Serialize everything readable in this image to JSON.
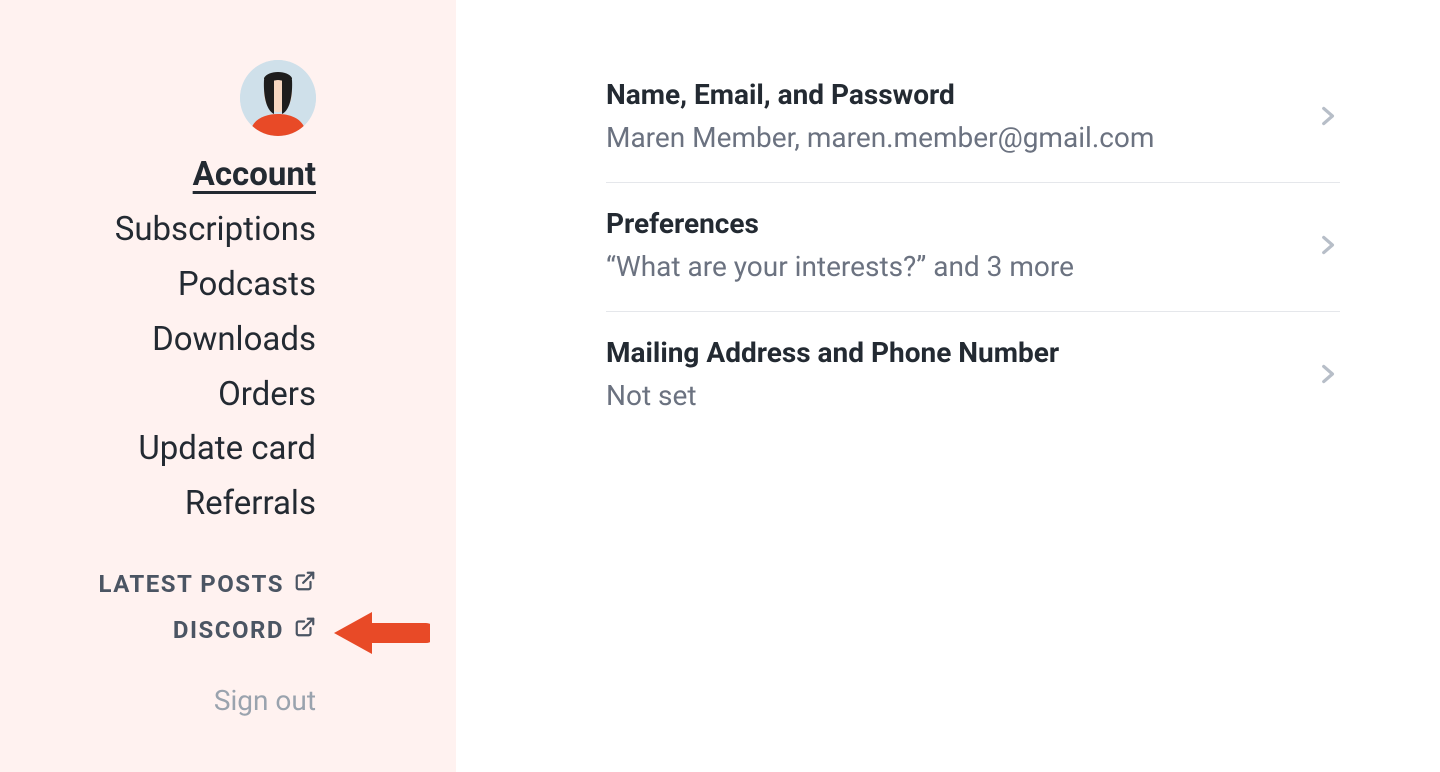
{
  "sidebar": {
    "nav": {
      "account": "Account",
      "subscriptions": "Subscriptions",
      "podcasts": "Podcasts",
      "downloads": "Downloads",
      "orders": "Orders",
      "update_card": "Update card",
      "referrals": "Referrals"
    },
    "external": {
      "latest_posts": "LATEST POSTS",
      "discord": "DISCORD"
    },
    "signout": "Sign out"
  },
  "main": {
    "rows": {
      "identity": {
        "title": "Name, Email, and Password",
        "subtitle": "Maren Member, maren.member@gmail.com"
      },
      "preferences": {
        "title": "Preferences",
        "subtitle": "“What are your interests?” and 3 more"
      },
      "mailing": {
        "title": "Mailing Address and Phone Number",
        "subtitle": "Not set"
      }
    }
  }
}
